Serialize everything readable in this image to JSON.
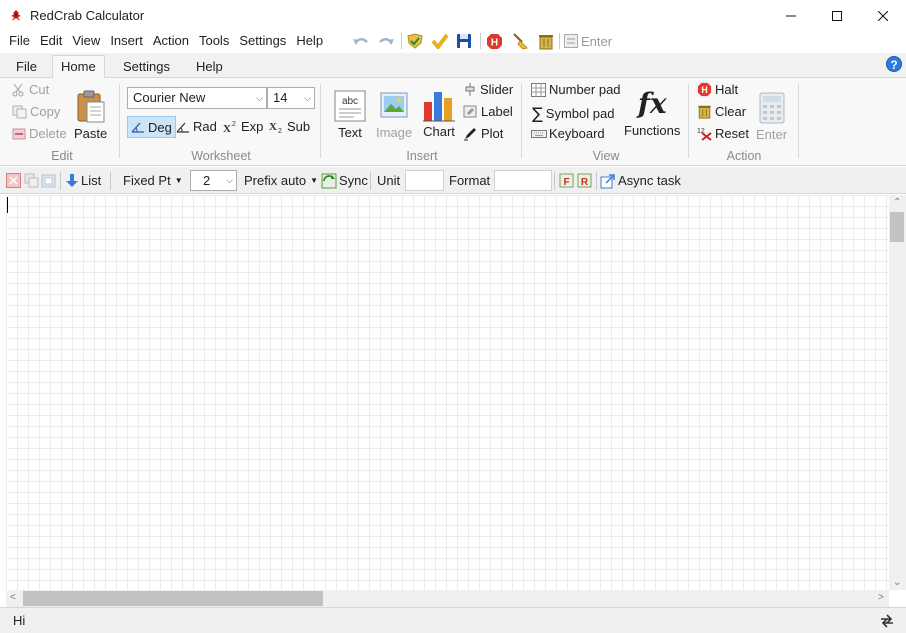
{
  "window": {
    "title": "RedCrab Calculator"
  },
  "menu": [
    "File",
    "Edit",
    "View",
    "Insert",
    "Action",
    "Tools",
    "Settings",
    "Help"
  ],
  "quick_access": {
    "enter_label": "Enter"
  },
  "ribbon_tabs": [
    "File",
    "Home",
    "Settings",
    "Help"
  ],
  "active_tab": "Home",
  "groups": {
    "edit": {
      "label": "Edit",
      "cut": "Cut",
      "copy": "Copy",
      "delete": "Delete",
      "paste": "Paste"
    },
    "worksheet": {
      "label": "Worksheet",
      "font": "Courier New",
      "size": "14",
      "deg": "Deg",
      "rad": "Rad",
      "exp": "Exp",
      "sub": "Sub"
    },
    "insert": {
      "label": "Insert",
      "text": "Text",
      "image": "Image",
      "chart": "Chart",
      "slider": "Slider",
      "label_btn": "Label",
      "plot": "Plot"
    },
    "view": {
      "label": "View",
      "number_pad": "Number pad",
      "symbol_pad": "Symbol pad",
      "keyboard": "Keyboard",
      "functions": "Functions",
      "fx": "fx"
    },
    "action": {
      "label": "Action",
      "halt": "Halt",
      "clear": "Clear",
      "reset": "Reset",
      "enter": "Enter"
    }
  },
  "toolbar": {
    "list": "List",
    "fixed_pt": "Fixed Pt",
    "decimals": "2",
    "prefix": "Prefix auto",
    "sync": "Sync",
    "unit_label": "Unit",
    "unit_value": "",
    "format_label": "Format",
    "format_value": "",
    "async": "Async task"
  },
  "status": {
    "text": "Hi"
  },
  "colors": {
    "accent": "#2d79d8",
    "halt_red": "#e03a2f",
    "selected_bg": "#cce4f7",
    "grid": "#ececec"
  }
}
